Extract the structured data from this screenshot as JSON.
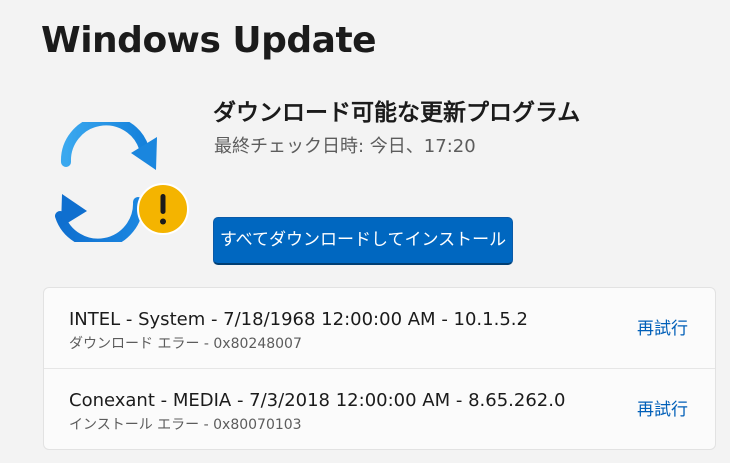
{
  "page": {
    "title": "Windows Update"
  },
  "status": {
    "icon": "sync-warning-icon",
    "title": "ダウンロード可能な更新プログラム",
    "last_checked": "最終チェック日時: 今日、17:20"
  },
  "actions": {
    "install_all_label": "すべてダウンロードしてインストール"
  },
  "updates": [
    {
      "name": "INTEL - System - 7/18/1968 12:00:00 AM - 10.1.5.2",
      "error": "ダウンロード エラー - 0x80248007",
      "retry_label": "再試行"
    },
    {
      "name": "Conexant - MEDIA - 7/3/2018 12:00:00 AM - 8.65.262.0",
      "error": "インストール エラー - 0x80070103",
      "retry_label": "再試行"
    }
  ],
  "colors": {
    "accent": "#0067c0",
    "link": "#005fb8",
    "warning": "#f4b400",
    "sync_arrow_light": "#4cc2ff",
    "sync_arrow_dark": "#0078d4"
  }
}
